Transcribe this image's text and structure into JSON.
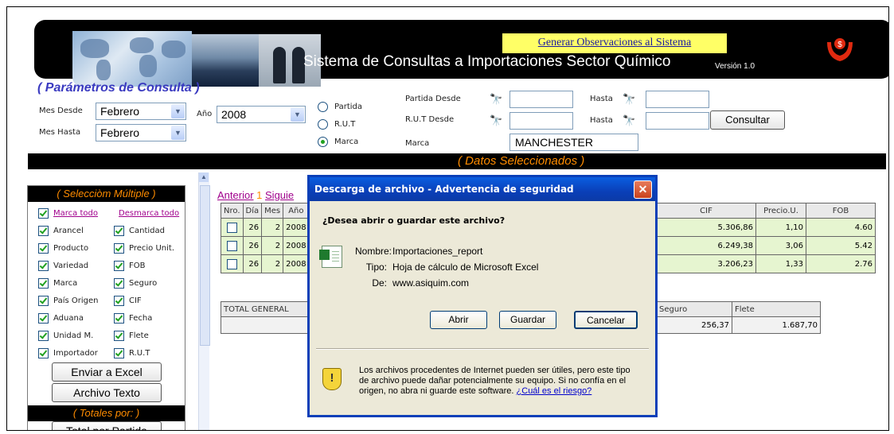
{
  "header": {
    "generate_link": "Generar Observaciones al Sistema",
    "title": "Sistema de Consultas  a Importaciones  Sector Químico",
    "version": "Versión 1.0"
  },
  "params": {
    "section_title": "( Parámetros de Consulta )",
    "mes_desde_label": "Mes Desde",
    "mes_desde_value": "Febrero",
    "mes_hasta_label": "Mes Hasta",
    "mes_hasta_value": "Febrero",
    "anio_label": "Año",
    "anio_value": "2008",
    "radios": [
      {
        "label": "Partida",
        "checked": false
      },
      {
        "label": "R.U.T",
        "checked": false
      },
      {
        "label": "Marca",
        "checked": true
      }
    ],
    "partida_desde_label": "Partida Desde",
    "rut_desde_label": "R.U.T Desde",
    "marca_label": "Marca",
    "hasta_label": "Hasta",
    "marca_value": "MANCHESTER",
    "consultar_label": "Consultar"
  },
  "selected_bar": "( Datos Seleccionados )",
  "left_panel": {
    "title": "( Selecciòm Múltiple )",
    "marca_todo": "Marca todo",
    "desmarca_todo": "Desmarca todo",
    "left_items": [
      "Arancel",
      "Producto",
      "Variedad",
      "Marca",
      "País Origen",
      "Aduana",
      "Unidad M.",
      "Importador"
    ],
    "right_items": [
      "Cantidad",
      "Precio Unit.",
      "FOB",
      "Seguro",
      "CIF",
      "Fecha",
      "Flete",
      "R.U.T"
    ],
    "enviar_excel": "Enviar a Excel",
    "archivo_texto": "Archivo Texto",
    "totales_title": "( Totales por: )",
    "total_partida": "Total  por  Partida"
  },
  "pager": {
    "anterior": "Anterior",
    "page": "1",
    "siguiente": "Siguie"
  },
  "grid": {
    "headers": [
      "Nro.",
      "Día",
      "Mes",
      "Año"
    ],
    "right_headers": [
      "CIF",
      "Precio.U.",
      "FOB"
    ],
    "rows": [
      {
        "dia": "26",
        "mes": "2",
        "anio": "2008",
        "cif": "5.306,86",
        "precio": "1,10",
        "fob": "4.60"
      },
      {
        "dia": "26",
        "mes": "2",
        "anio": "2008",
        "cif": "6.249,38",
        "precio": "3,06",
        "fob": "5.42"
      },
      {
        "dia": "26",
        "mes": "2",
        "anio": "2008",
        "cif": "3.206,23",
        "precio": "1,33",
        "fob": "2.76"
      }
    ]
  },
  "totals": {
    "label": "TOTAL GENERAL",
    "seguro_label": "Seguro",
    "flete_label": "Flete",
    "seguro_value": "256,37",
    "flete_value": "1.687,70"
  },
  "dialog": {
    "title": "Descarga de archivo - Advertencia de seguridad",
    "question": "¿Desea abrir o guardar este archivo?",
    "nombre_label": "Nombre:",
    "nombre_value": "Importaciones_report",
    "tipo_label": "Tipo:",
    "tipo_value": "Hoja de cálculo de Microsoft Excel",
    "de_label": "De:",
    "de_value": "www.asiquim.com",
    "abrir": "Abrir",
    "guardar": "Guardar",
    "cancelar": "Cancelar",
    "warning": "Los archivos procedentes de Internet pueden ser útiles, pero este tipo de archivo puede dañar potencialmente su equipo. Si no confía en el origen, no abra ni guarde este software.",
    "risk_link": "¿Cuál es el riesgo?"
  }
}
